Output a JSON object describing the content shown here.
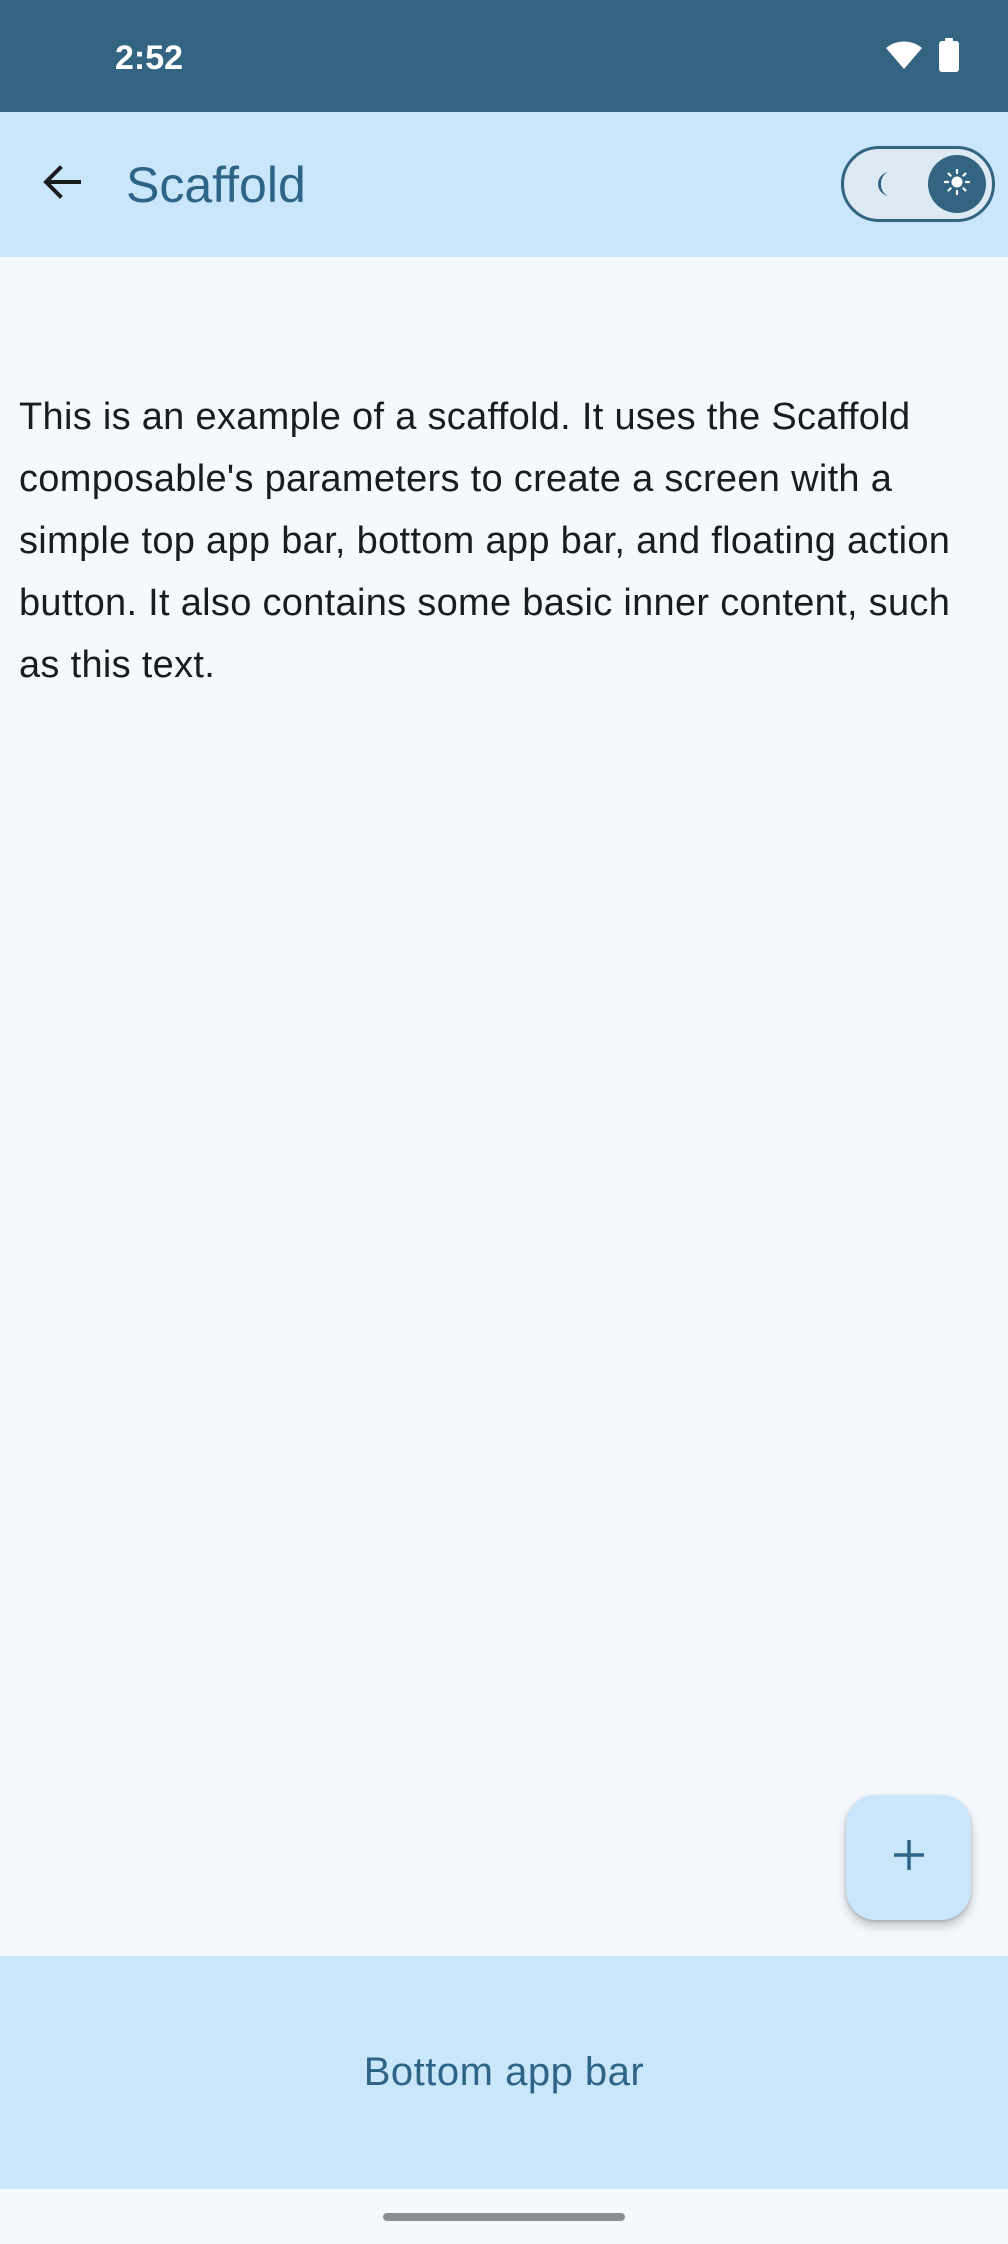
{
  "status_bar": {
    "time": "2:52",
    "icons": [
      "wifi-icon",
      "battery-icon"
    ]
  },
  "top_bar": {
    "title": "Scaffold",
    "back_icon": "arrow-back-icon",
    "theme_toggle": {
      "left_icon": "moon-icon",
      "right_icon": "sun-icon",
      "selected": "light"
    }
  },
  "content": {
    "text": "This is an example of a scaffold. It uses the Scaffold composable's parameters to create a screen with a simple top app bar, bottom app bar, and floating action button. It also contains some basic inner content, such as this text."
  },
  "fab": {
    "icon": "plus-icon"
  },
  "bottom_bar": {
    "text": "Bottom app bar"
  },
  "colors": {
    "status_bar": "#336482",
    "app_bar": "#cae6fb",
    "background": "#f5f9fe",
    "accent": "#2e6587",
    "text": "#1b1c1e"
  }
}
